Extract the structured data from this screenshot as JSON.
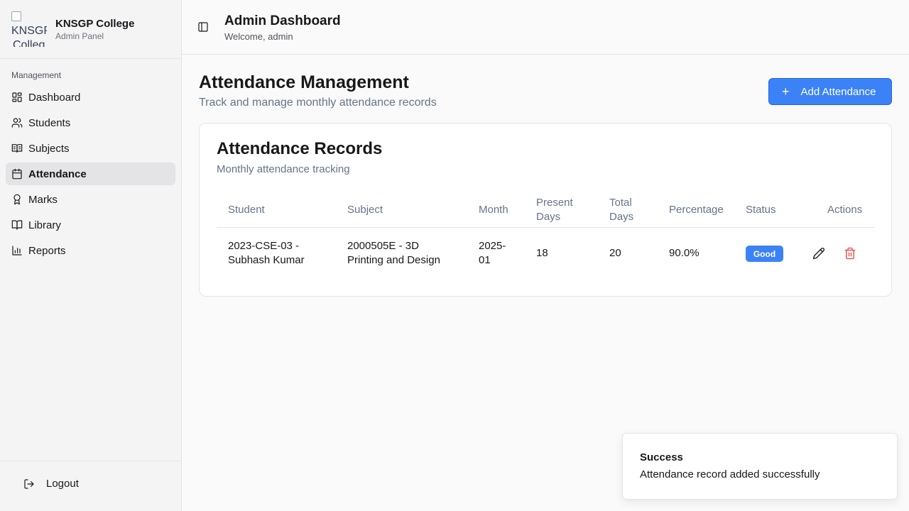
{
  "sidebar": {
    "logo_alt_line1": "KNSGP",
    "logo_alt_line2": "Colleg",
    "brand_title": "KNSGP College",
    "brand_subtitle": "Admin Panel",
    "group_label": "Management",
    "items": [
      {
        "label": "Dashboard",
        "icon": "dashboard-icon"
      },
      {
        "label": "Students",
        "icon": "users-icon"
      },
      {
        "label": "Subjects",
        "icon": "book-open-icon"
      },
      {
        "label": "Attendance",
        "icon": "calendar-icon",
        "active": true
      },
      {
        "label": "Marks",
        "icon": "award-icon"
      },
      {
        "label": "Library",
        "icon": "library-book-icon"
      },
      {
        "label": "Reports",
        "icon": "bar-chart-icon"
      }
    ],
    "logout_label": "Logout"
  },
  "header": {
    "title": "Admin Dashboard",
    "subtitle": "Welcome, admin"
  },
  "main": {
    "title": "Attendance Management",
    "subtitle": "Track and manage monthly attendance records",
    "add_button_label": "Add Attendance"
  },
  "card": {
    "title": "Attendance Records",
    "subtitle": "Monthly attendance tracking",
    "columns": {
      "student": "Student",
      "subject": "Subject",
      "month": "Month",
      "present_days_1": "Present",
      "present_days_2": "Days",
      "total_days_1": "Total",
      "total_days_2": "Days",
      "percentage": "Percentage",
      "status": "Status",
      "actions": "Actions"
    },
    "rows": [
      {
        "student_1": "2023-CSE-03 -",
        "student_2": "Subhash Kumar",
        "subject_1": "2000505E - 3D",
        "subject_2": "Printing and Design",
        "month_1": "2025-",
        "month_2": "01",
        "present_days": "18",
        "total_days": "20",
        "percentage": "90.0%",
        "status": "Good"
      }
    ]
  },
  "toast": {
    "title": "Success",
    "message": "Attendance record added successfully"
  },
  "colors": {
    "accent": "#3b82f6",
    "danger": "#ef4444"
  }
}
